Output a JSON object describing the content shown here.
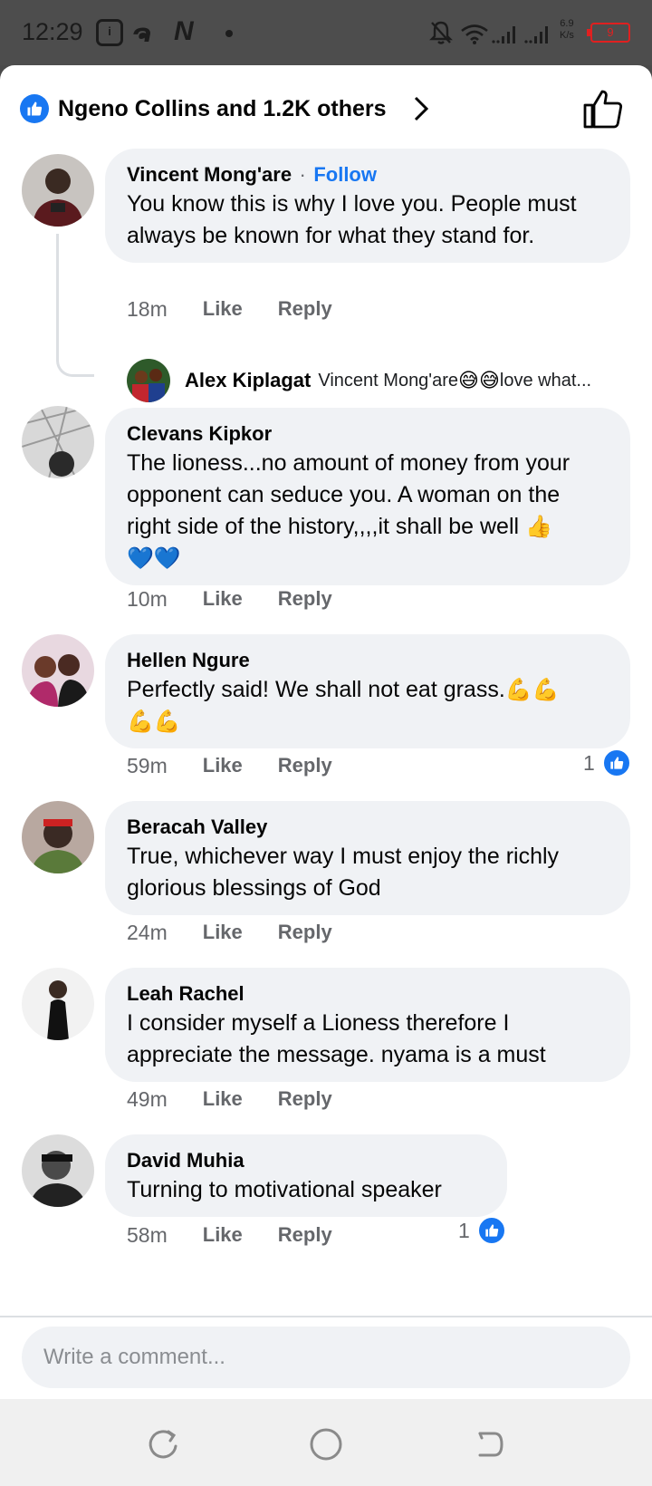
{
  "status_bar": {
    "time": "12:29",
    "speed_value": "6.9",
    "speed_unit": "K/s",
    "battery": "9",
    "icons": [
      "notification-box-icon",
      "app-icon",
      "netflix-n-icon",
      "dot-icon",
      "bell-off-icon",
      "wifi-icon",
      "signal-icon",
      "signal-icon",
      "battery-icon"
    ]
  },
  "reactions": {
    "summary": "Ngeno Collins and 1.2K others",
    "icon": "like-icon"
  },
  "comments": [
    {
      "author": "Vincent Mong'are",
      "follow": "Follow",
      "separator": "·",
      "text": "You know this is why I love you. People must always be known for what they stand for.",
      "time": "18m",
      "like": "Like",
      "reply": "Reply",
      "reply_preview": {
        "author": "Alex Kiplagat",
        "text_start": "Vincent Mong'are ",
        "emoji": "😅😅",
        "text_end": "love what..."
      }
    },
    {
      "author": "Clevans Kipkor",
      "text": "The lioness...no amount of money from your opponent can seduce you. A woman on the right side of the history,,,,it shall be well ",
      "emoji": "👍",
      "emoji2": "💙💙",
      "time": "10m",
      "like": "Like",
      "reply": "Reply"
    },
    {
      "author": "Hellen Ngure",
      "text": "Perfectly said! We shall not eat grass.",
      "emoji": "💪💪",
      "emoji2": "💪💪",
      "time": "59m",
      "like": "Like",
      "reply": "Reply",
      "reaction_count": "1"
    },
    {
      "author": "Beracah Valley",
      "text": "True, whichever way I must enjoy the richly glorious blessings of God",
      "time": "24m",
      "like": "Like",
      "reply": "Reply"
    },
    {
      "author": "Leah Rachel",
      "text": "I consider myself a Lioness therefore I appreciate the message. nyama is a must",
      "time": "49m",
      "like": "Like",
      "reply": "Reply"
    },
    {
      "author": "David Muhia",
      "text": "Turning  to motivational speaker",
      "time": "58m",
      "like": "Like",
      "reply": "Reply",
      "reaction_count": "1"
    }
  ],
  "composer": {
    "placeholder": "Write a comment..."
  },
  "colors": {
    "brand": "#1877f2",
    "bubble": "#f0f2f5",
    "meta": "#65676b"
  }
}
